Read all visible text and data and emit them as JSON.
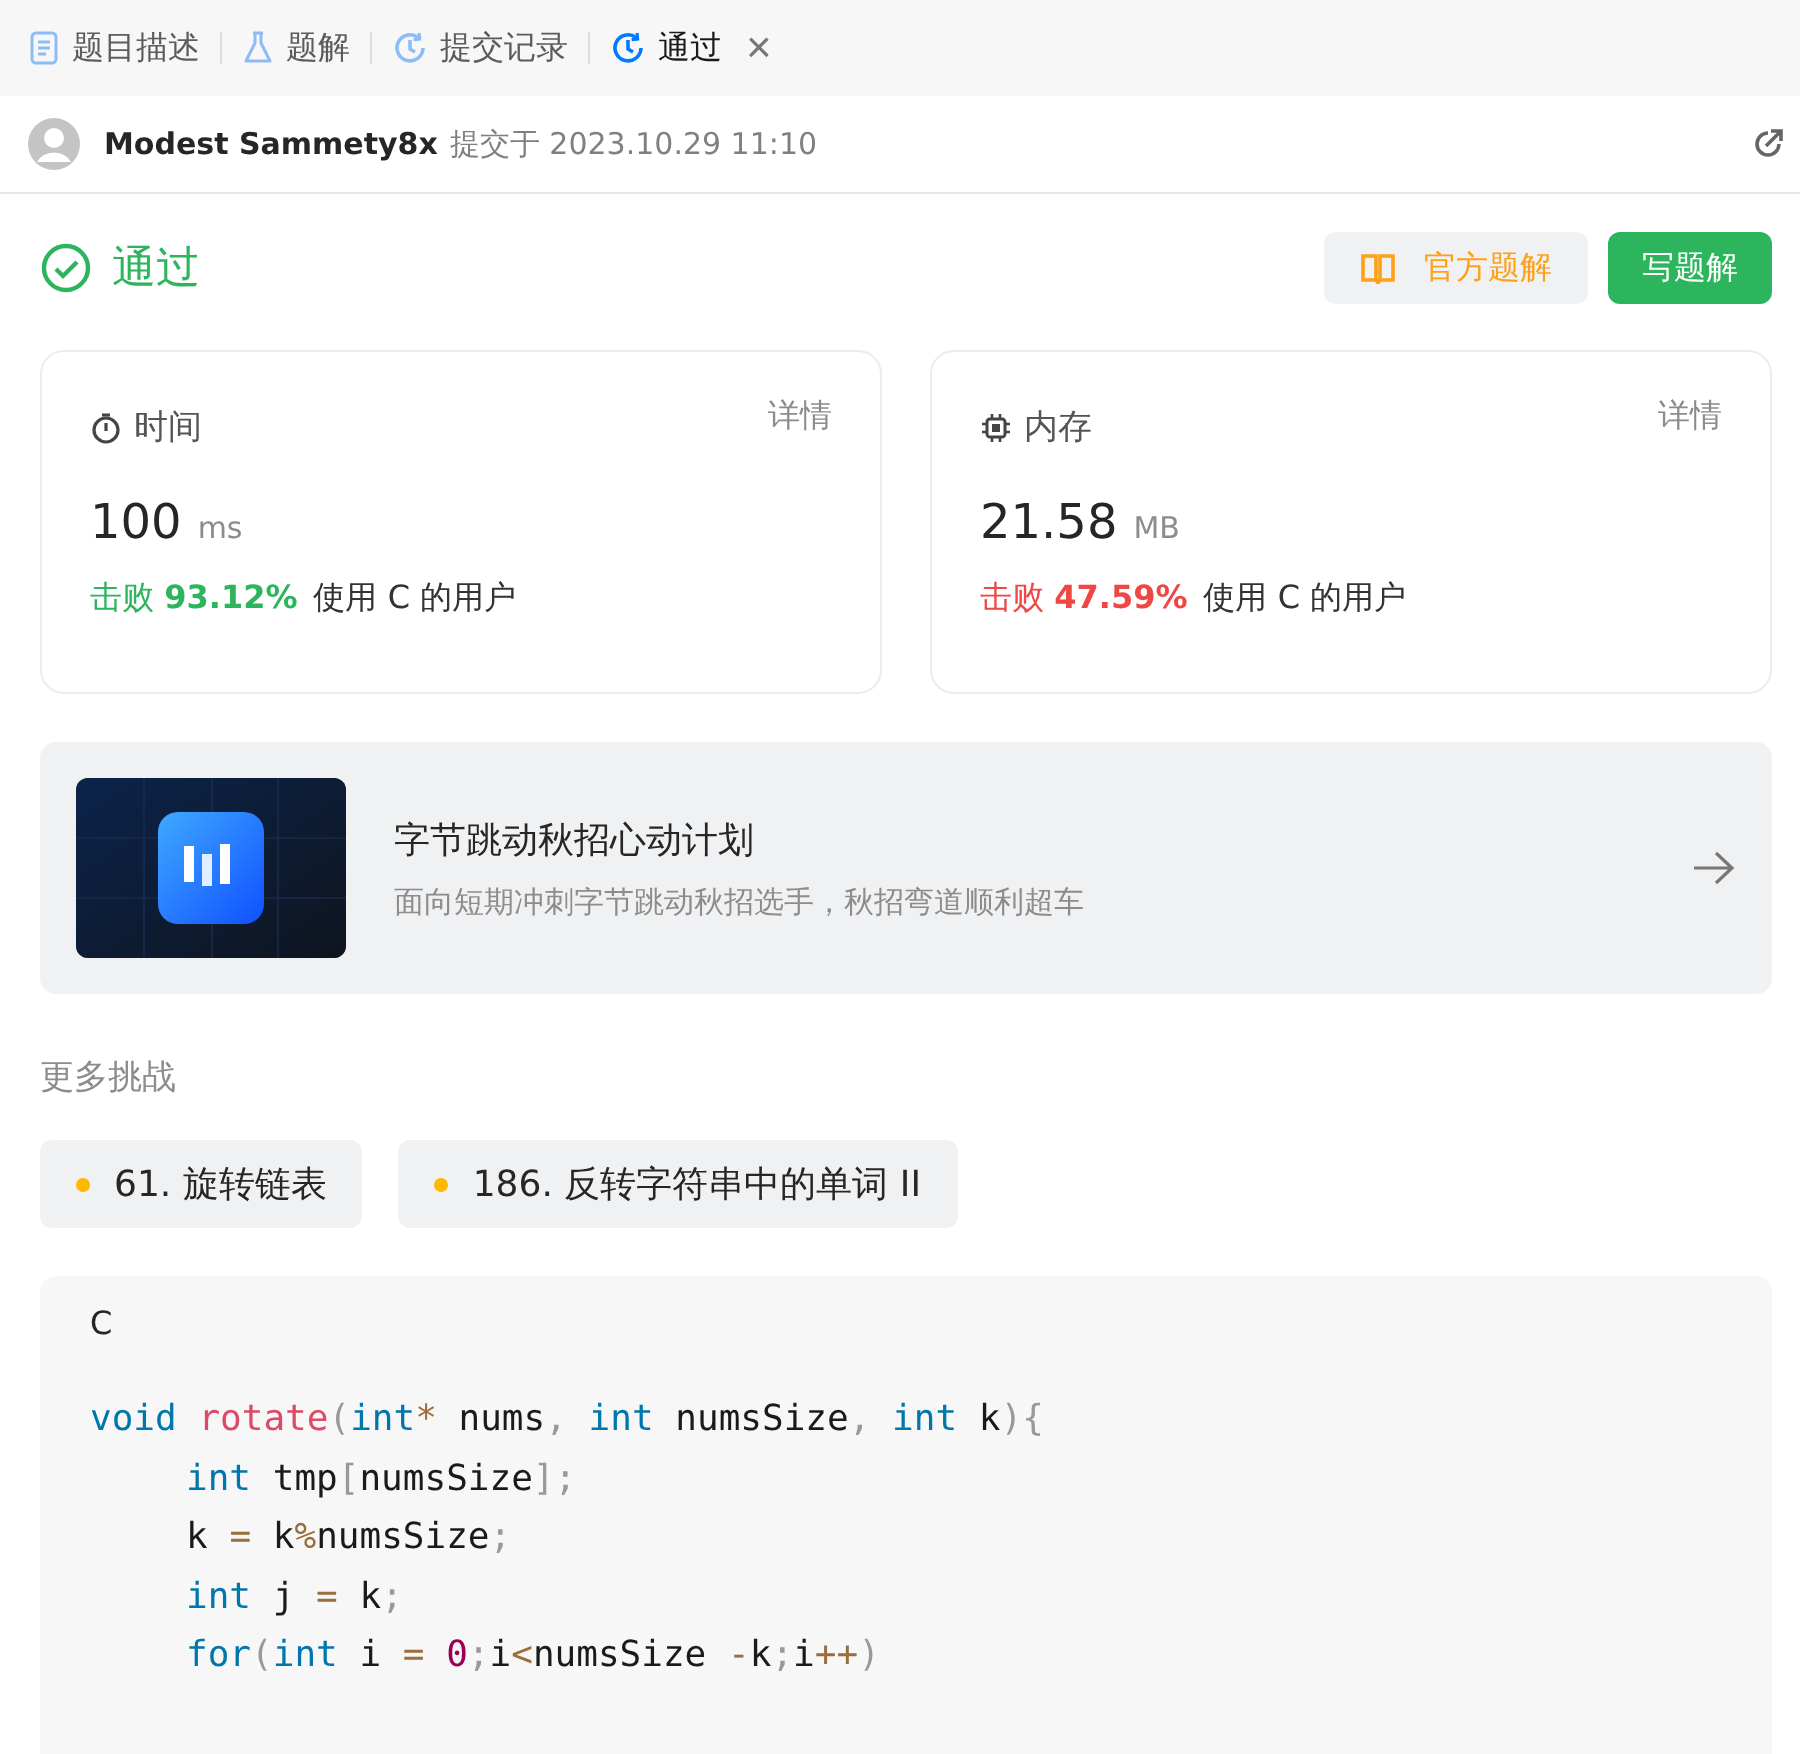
{
  "tabs": [
    {
      "label": "题目描述",
      "selected": false
    },
    {
      "label": "题解",
      "selected": false
    },
    {
      "label": "提交记录",
      "selected": false
    },
    {
      "label": "通过",
      "selected": true,
      "close": "×"
    }
  ],
  "submission": {
    "user": "Modest Sammety8x",
    "submitted_at": "提交于 2023.10.29 11:10"
  },
  "status": {
    "label": "通过",
    "buttons": [
      {
        "label": "官方题解",
        "kind": "secondary"
      },
      {
        "label": "写题解",
        "kind": "primary"
      }
    ]
  },
  "stats": [
    {
      "title": "时间",
      "details": "详情",
      "value": "100",
      "unit": "ms",
      "beat_label": "击败",
      "beat": "93.12%",
      "color": "#2db55d",
      "suffix": "使用 C 的用户"
    },
    {
      "title": "内存",
      "details": "详情",
      "value": "21.58",
      "unit": "MB",
      "beat_label": "击败",
      "beat": "47.59%",
      "color": "#ef4743",
      "suffix": "使用 C 的用户"
    }
  ],
  "banner": {
    "title": "字节跳动秋招心动计划",
    "subtitle": "面向短期冲刺字节跳动秋招选手，秋招弯道顺利超车"
  },
  "more": {
    "heading": "更多挑战",
    "items": [
      {
        "label": "61. 旋转链表",
        "color": "#ffb800"
      },
      {
        "label": "186. 反转字符串中的单词 II",
        "color": "#ffb800"
      }
    ]
  },
  "code": {
    "language": "C",
    "lines": [
      {
        "indented": false,
        "tokens": [
          {
            "text": "void ",
            "kind": "keyword"
          },
          {
            "text": "rotate",
            "kind": "function"
          },
          {
            "text": "(",
            "kind": "punct"
          },
          {
            "text": "int",
            "kind": "keyword"
          },
          {
            "text": "*",
            "kind": "operator"
          },
          {
            "text": " nums",
            "kind": "plain"
          },
          {
            "text": ", ",
            "kind": "punct"
          },
          {
            "text": "int",
            "kind": "keyword"
          },
          {
            "text": " numsSize",
            "kind": "plain"
          },
          {
            "text": ", ",
            "kind": "punct"
          },
          {
            "text": "int",
            "kind": "keyword"
          },
          {
            "text": " k",
            "kind": "plain"
          },
          {
            "text": "){",
            "kind": "punct"
          }
        ]
      },
      {
        "indented": true,
        "tokens": [
          {
            "text": "int",
            "kind": "keyword"
          },
          {
            "text": " tmp",
            "kind": "plain"
          },
          {
            "text": "[",
            "kind": "punct"
          },
          {
            "text": "numsSize",
            "kind": "plain"
          },
          {
            "text": "];",
            "kind": "punct"
          }
        ]
      },
      {
        "indented": true,
        "tokens": [
          {
            "text": "k ",
            "kind": "plain"
          },
          {
            "text": "=",
            "kind": "operator"
          },
          {
            "text": " k",
            "kind": "plain"
          },
          {
            "text": "%",
            "kind": "operator"
          },
          {
            "text": "numsSize",
            "kind": "plain"
          },
          {
            "text": ";",
            "kind": "punct"
          }
        ]
      },
      {
        "indented": true,
        "tokens": [
          {
            "text": "int",
            "kind": "keyword"
          },
          {
            "text": " j ",
            "kind": "plain"
          },
          {
            "text": "=",
            "kind": "operator"
          },
          {
            "text": " k",
            "kind": "plain"
          },
          {
            "text": ";",
            "kind": "punct"
          }
        ]
      },
      {
        "indented": true,
        "tokens": [
          {
            "text": "for",
            "kind": "keyword"
          },
          {
            "text": "(",
            "kind": "punct"
          },
          {
            "text": "int",
            "kind": "keyword"
          },
          {
            "text": " i ",
            "kind": "plain"
          },
          {
            "text": "= ",
            "kind": "operator"
          },
          {
            "text": "0",
            "kind": "number"
          },
          {
            "text": ";",
            "kind": "punct"
          },
          {
            "text": "i",
            "kind": "plain"
          },
          {
            "text": "<",
            "kind": "operator"
          },
          {
            "text": "numsSize ",
            "kind": "plain"
          },
          {
            "text": "-",
            "kind": "operator"
          },
          {
            "text": "k",
            "kind": "plain"
          },
          {
            "text": ";",
            "kind": "punct"
          },
          {
            "text": "i",
            "kind": "plain"
          },
          {
            "text": "++",
            "kind": "operator"
          },
          {
            "text": ")",
            "kind": "punct"
          }
        ]
      }
    ]
  }
}
